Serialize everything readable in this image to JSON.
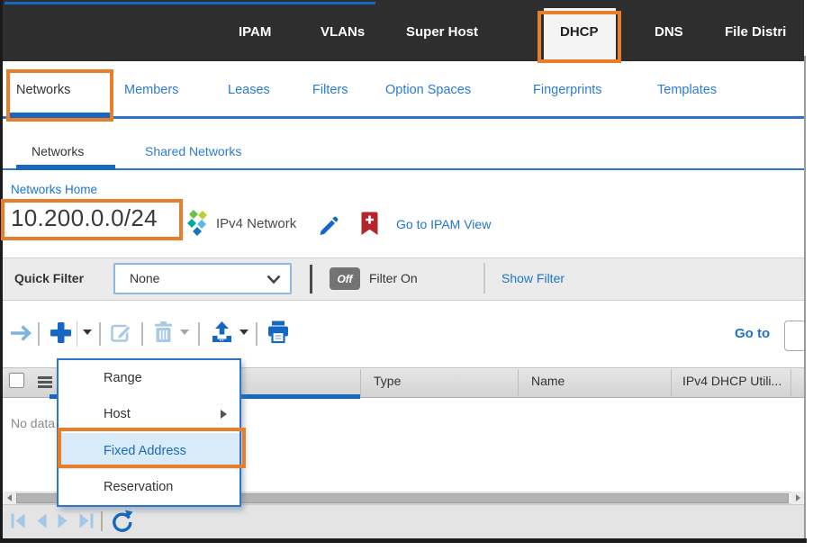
{
  "colors": {
    "annotation_orange": "#E87D2A",
    "nav_bg": "#2E2E2E",
    "accent_blue": "#1668C1",
    "link_blue": "#1E74D0",
    "menu_highlight_bg": "#D9EAF8",
    "bookmark_red": "#B6252A",
    "disabled_icon_blue": "#A9C9E6"
  },
  "nav": {
    "selected": "DHCP",
    "tabs": [
      {
        "label": "IPAM"
      },
      {
        "label": "VLANs"
      },
      {
        "label": "Super Host"
      },
      {
        "label": "DHCP"
      },
      {
        "label": "DNS"
      },
      {
        "label": "File Distri"
      }
    ]
  },
  "subtabs": {
    "selected": "Networks",
    "items": [
      {
        "label": "Networks"
      },
      {
        "label": "Members"
      },
      {
        "label": "Leases"
      },
      {
        "label": "Filters"
      },
      {
        "label": "Option Spaces"
      },
      {
        "label": "Fingerprints"
      },
      {
        "label": "Templates"
      }
    ]
  },
  "view_tabs": {
    "selected": "Networks",
    "items": [
      {
        "label": "Networks"
      },
      {
        "label": "Shared Networks"
      }
    ]
  },
  "breadcrumb": {
    "label": "Networks Home"
  },
  "network_header": {
    "address": "10.200.0.0/24",
    "type_label": "IPv4 Network",
    "ipam_link_label": "Go to IPAM View"
  },
  "quick_filter": {
    "label": "Quick Filter",
    "selected_option": "None",
    "toggle_state": "Off",
    "toggle_label": "Filter On",
    "show_filter_label": "Show Filter"
  },
  "toolbar": {
    "goto_label": "Go to",
    "goto_value": ""
  },
  "table": {
    "columns": [
      {
        "label": "Type"
      },
      {
        "label": "Name"
      },
      {
        "label": "IPv4 DHCP Utili..."
      }
    ],
    "empty_message": "No data"
  },
  "add_menu": {
    "items": [
      {
        "label": "Range"
      },
      {
        "label": "Host",
        "has_submenu": true
      },
      {
        "label": "Fixed Address",
        "highlighted": true
      },
      {
        "label": "Reservation"
      }
    ]
  }
}
